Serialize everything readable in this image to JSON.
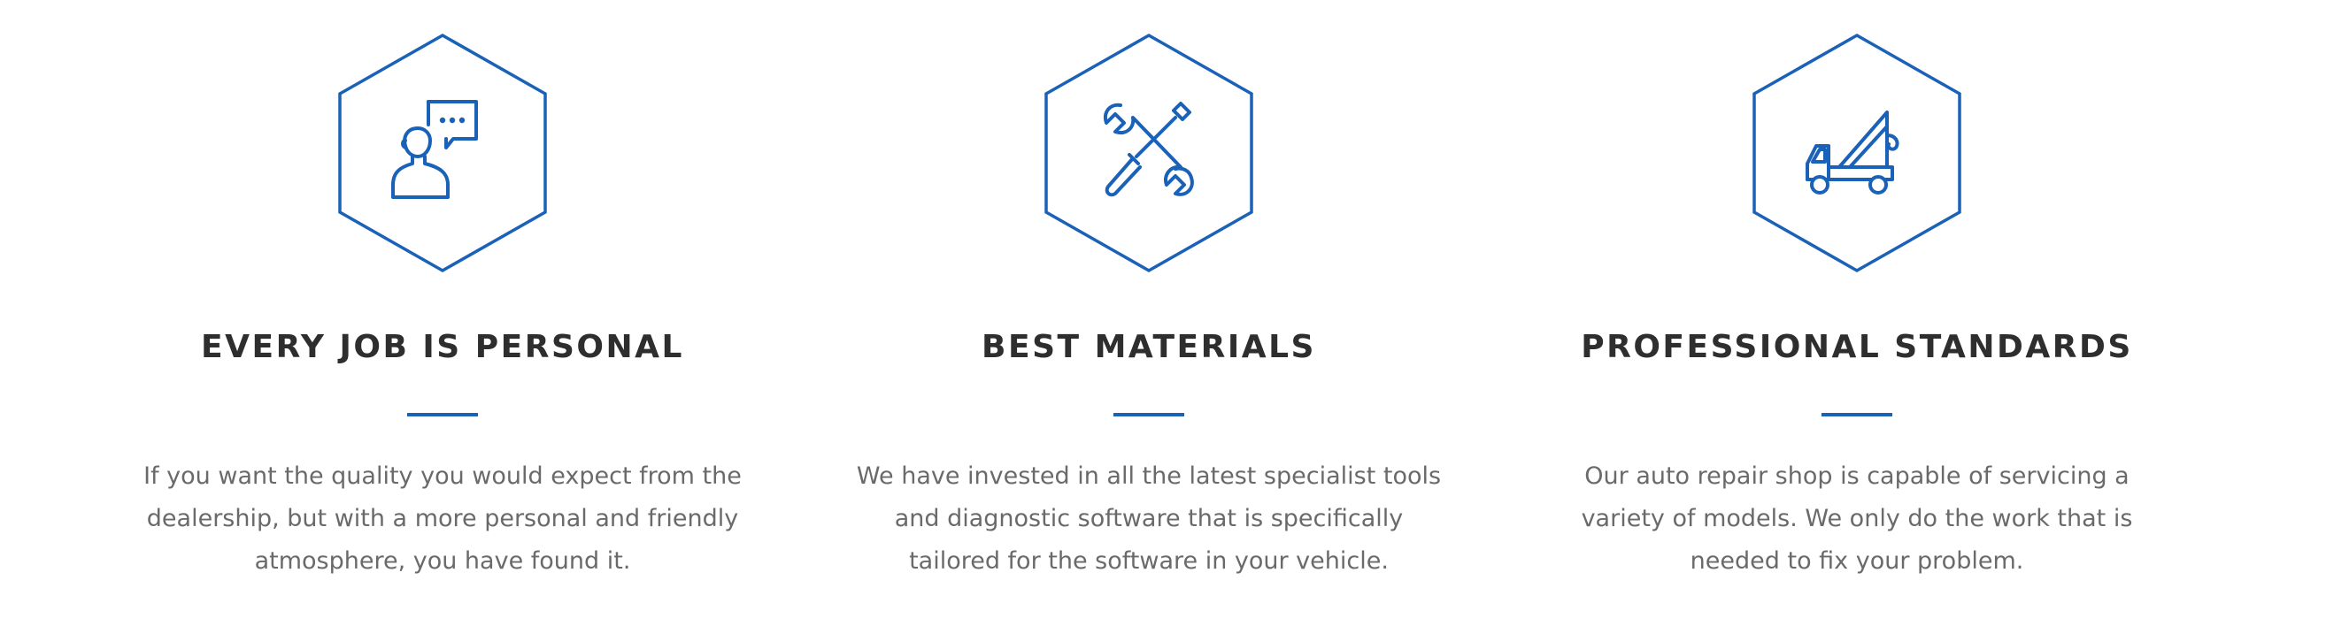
{
  "brand": {
    "accent": "#1a61b8",
    "heading_color": "#2e2e2e",
    "text_color": "#6a6a6a"
  },
  "features": [
    {
      "icon": "person-speech-bubble-icon",
      "title": "EVERY JOB IS PERSONAL",
      "description": "If you want the quality you would expect from the dealership, but with a more personal and friendly atmosphere, you have found it."
    },
    {
      "icon": "wrench-screwdriver-icon",
      "title": "BEST MATERIALS",
      "description": "We have invested in all the latest specialist tools and diagnostic software that is specifically tailored for the software in your vehicle."
    },
    {
      "icon": "tow-truck-icon",
      "title": "PROFESSIONAL STANDARDS",
      "description": "Our auto repair shop is capable of servicing a variety of models. We only do the work that is needed to fix your problem."
    }
  ]
}
